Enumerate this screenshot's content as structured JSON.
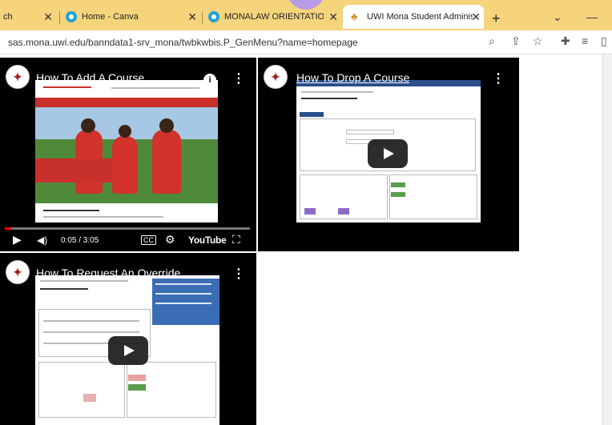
{
  "browser": {
    "tabs": [
      {
        "label": "ch",
        "active": false
      },
      {
        "label": "Home - Canva",
        "active": false
      },
      {
        "label": "MONALAW ORIENTATION G",
        "active": false
      },
      {
        "label": "UWI Mona Student Administ",
        "active": true
      }
    ],
    "close_glyph": "✕",
    "new_tab_glyph": "+",
    "url": "sas.mona.uwi.edu/banndata1-srv_mona/twbkwbis.P_GenMenu?name=homepage"
  },
  "videos": [
    {
      "title": "How To Add A Course",
      "time": "0:05 / 3:05",
      "brand": "YouTube",
      "progress": 0.027
    },
    {
      "title": "How To Drop A Course"
    },
    {
      "title": "How To Request An Override"
    }
  ],
  "icons": {
    "menu": "⋮",
    "info": "i",
    "play": "▶",
    "volume": "🔊",
    "cc": "CC",
    "settings": "⚙",
    "fullscreen": "⛶"
  }
}
